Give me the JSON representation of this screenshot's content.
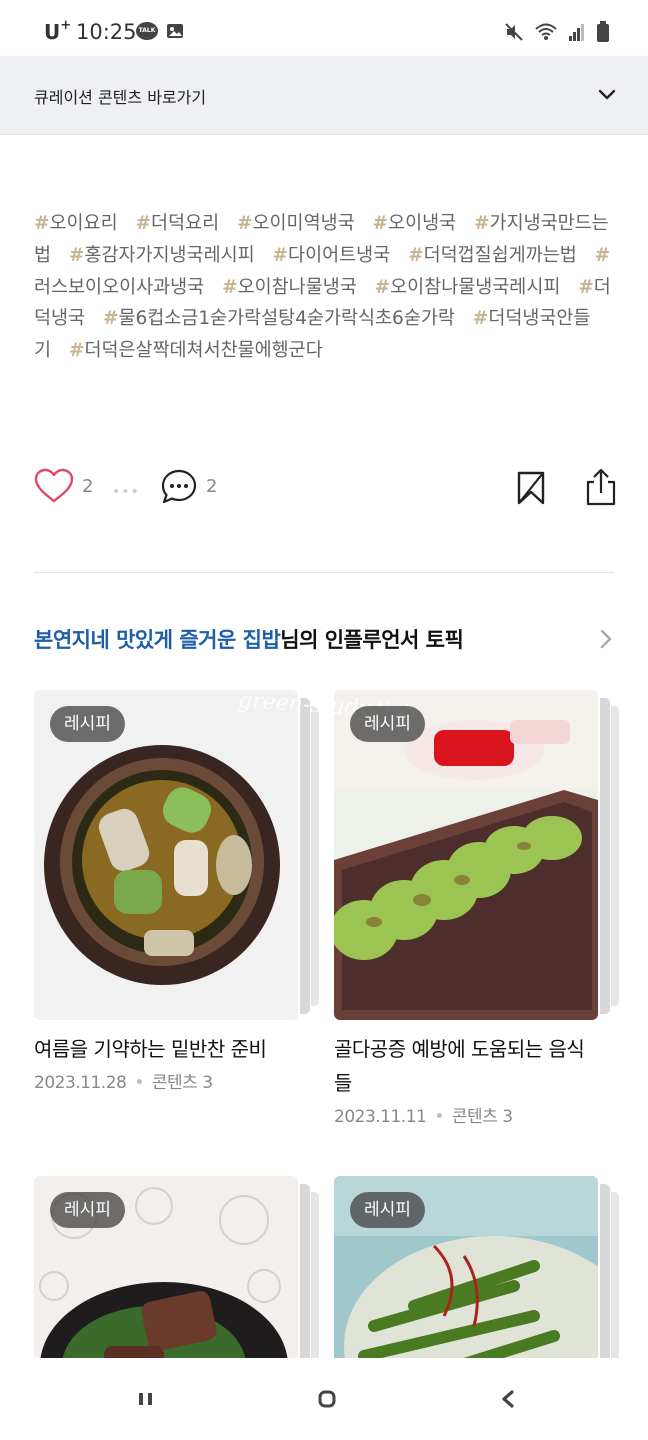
{
  "status_bar": {
    "carrier": "U",
    "carrier_plus": "+",
    "time": "10:25",
    "talk_badge": "TALK"
  },
  "curation": {
    "label": "큐레이션 콘텐츠 바로가기"
  },
  "tags": [
    "오이요리",
    "더덕요리",
    "오이미역냉국",
    "오이냉국",
    "가지냉국만드는법",
    "홍감자가지냉국레시피",
    "다이어트냉국",
    "더덕껍질쉽게까는법",
    "러스보이오이사과냉국",
    "오이참나물냉국",
    "오이참나물냉국레시피",
    "더덕냉국",
    "물6컵소금1숟가락설탕4숟가락식초6숟가락",
    "더덕냉국안들기",
    "더덕은살짝데쳐서찬물에헹군다"
  ],
  "tag_hash_symbol": "#",
  "actions": {
    "like_count": "2",
    "dots": "•••",
    "comment_count": "2"
  },
  "topic": {
    "blog_name": "본연지네 맛있게 즐거운 집밥",
    "suffix": "님의 인플루언서 토픽"
  },
  "cards": [
    {
      "badge": "레시피",
      "title": "여름을 기약하는 밑반찬 준비",
      "date": "2023.11.28",
      "separator": "•",
      "contents": "콘텐츠 3"
    },
    {
      "badge": "레시피",
      "title": "골다공증 예방에 도움되는 음식들",
      "date": "2023.11.11",
      "separator": "•",
      "contents": "콘텐츠 3",
      "watermark": "green-study.tistory.com"
    },
    {
      "badge": "레시피"
    },
    {
      "badge": "레시피"
    }
  ],
  "colors": {
    "accent_blue": "#1e5fa8",
    "heart_pink": "#e0476a",
    "hash_gold": "#c9b48f",
    "curation_bg": "#eef0f3"
  }
}
